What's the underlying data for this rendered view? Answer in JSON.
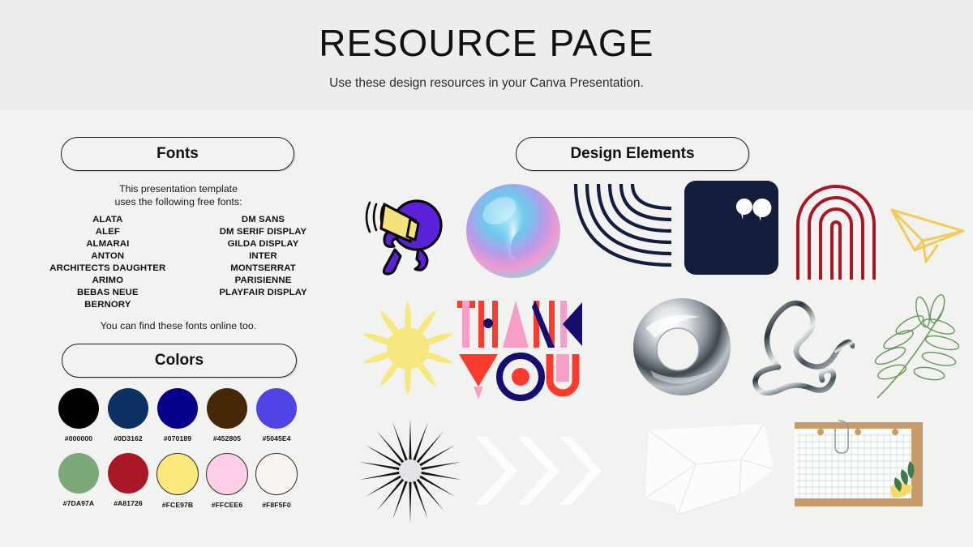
{
  "header": {
    "title": "RESOURCE PAGE",
    "subtitle": "Use these design resources in your Canva Presentation."
  },
  "fonts_section": {
    "pill_label": "Fonts",
    "intro_line1": "This presentation template",
    "intro_line2": "uses the following free fonts:",
    "outro": "You can find these fonts online too.",
    "column_left": [
      "ALATA",
      "ALEF",
      "ALMARAI",
      "ANTON",
      "ARCHITECTS DAUGHTER",
      "ARIMO",
      "BEBAS NEUE",
      "BERNORY"
    ],
    "column_right": [
      "DM SANS",
      "DM SERIF DISPLAY",
      "GILDA DISPLAY",
      "INTER",
      "MONTSERRAT",
      "PARISIENNE",
      "PLAYFAIR DISPLAY"
    ]
  },
  "colors_section": {
    "pill_label": "Colors",
    "row1": [
      {
        "hex": "#000000",
        "label": "#000000"
      },
      {
        "hex": "#0D3162",
        "label": "#0D3162"
      },
      {
        "hex": "#070189",
        "label": "#070189"
      },
      {
        "hex": "#452805",
        "label": "#452805"
      },
      {
        "hex": "#5045E4",
        "label": "#5045E4"
      }
    ],
    "row2": [
      {
        "hex": "#7DA97A",
        "label": "#7DA97A"
      },
      {
        "hex": "#A81726",
        "label": "#A81726"
      },
      {
        "hex": "#FCE97B",
        "label": "#FCE97B"
      },
      {
        "hex": "#FFCEE6",
        "label": "#FFCEE6"
      },
      {
        "hex": "#F8F5F0",
        "label": "#F8F5F0"
      }
    ]
  },
  "elements_section": {
    "pill_label": "Design Elements",
    "items": [
      "megaphone-character-illustration",
      "iridescent-gradient-sphere",
      "curved-stripe-lines",
      "quote-card",
      "concentric-arch-outline",
      "paper-plane-outline",
      "yellow-starburst-flower",
      "thank-you-geometric-lettering",
      "chrome-torus",
      "chrome-squiggle",
      "fern-leaf-line-art",
      "black-starburst",
      "white-chevron-arrows",
      "crumpled-paper",
      "grid-paper-collage"
    ]
  },
  "palette": {
    "band_bg": "#ededed",
    "page_bg": "#f2f2f1",
    "ink": "#111111",
    "navy": "#141E3C",
    "purple": "#5A22D8",
    "yellow": "#F6E27A",
    "dark_red": "#A81726",
    "red": "#FB3B2E",
    "pink": "#F79FC9",
    "deep_navy": "#140F6E",
    "green": "#6E9A62",
    "tan": "#C89B6A"
  }
}
